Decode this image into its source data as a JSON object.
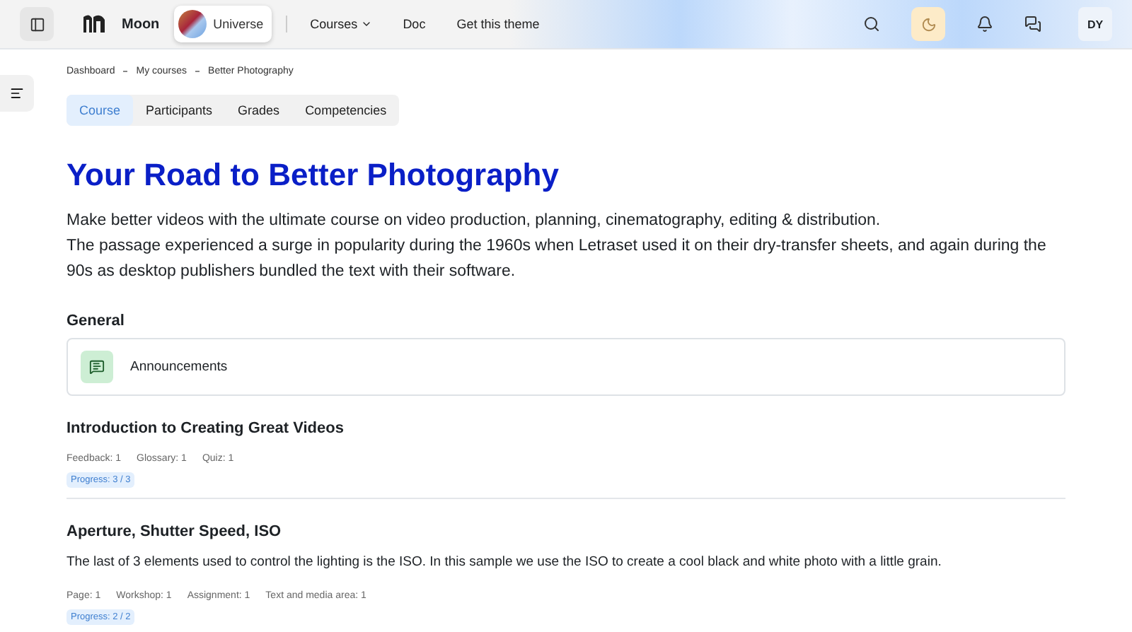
{
  "header": {
    "brand": "Moon",
    "theme_switch": "Universe",
    "nav": [
      {
        "label": "Courses",
        "dropdown": true
      },
      {
        "label": "Doc",
        "dropdown": false
      },
      {
        "label": "Get this theme",
        "dropdown": false
      }
    ],
    "dark_mode": {
      "on": true
    },
    "avatar": "DY"
  },
  "breadcrumb": [
    "Dashboard",
    "My courses",
    "Better Photography"
  ],
  "tabs": [
    {
      "label": "Course",
      "selected": true
    },
    {
      "label": "Participants",
      "selected": false
    },
    {
      "label": "Grades",
      "selected": false
    },
    {
      "label": "Competencies",
      "selected": false
    }
  ],
  "title": "Your Road to Better Photography",
  "summary": [
    "Make better videos with the ultimate course on video production, planning, cinematography, editing & distribution.",
    "The passage experienced a surge in popularity during the 1960s when Letraset used it on their dry-transfer sheets, and again during the 90s as desktop publishers bundled the text with their software."
  ],
  "general": {
    "heading": "General",
    "items": [
      "Announcements"
    ]
  },
  "sections": [
    {
      "title": "Introduction to Creating Great Videos",
      "activities": [
        "Feedback: 1",
        "Glossary: 1",
        "Quiz: 1"
      ],
      "progress": "Progress: 3 / 3"
    },
    {
      "title": "Aperture, Shutter Speed, ISO",
      "description": "The last of 3 elements used to control the lighting is the ISO. In this sample we use the ISO to create a cool black and white photo with a little grain.",
      "activities": [
        "Page: 1",
        "Workshop: 1",
        "Assignment: 1",
        "Text and media area: 1"
      ],
      "progress": "Progress: 2 / 2"
    }
  ]
}
